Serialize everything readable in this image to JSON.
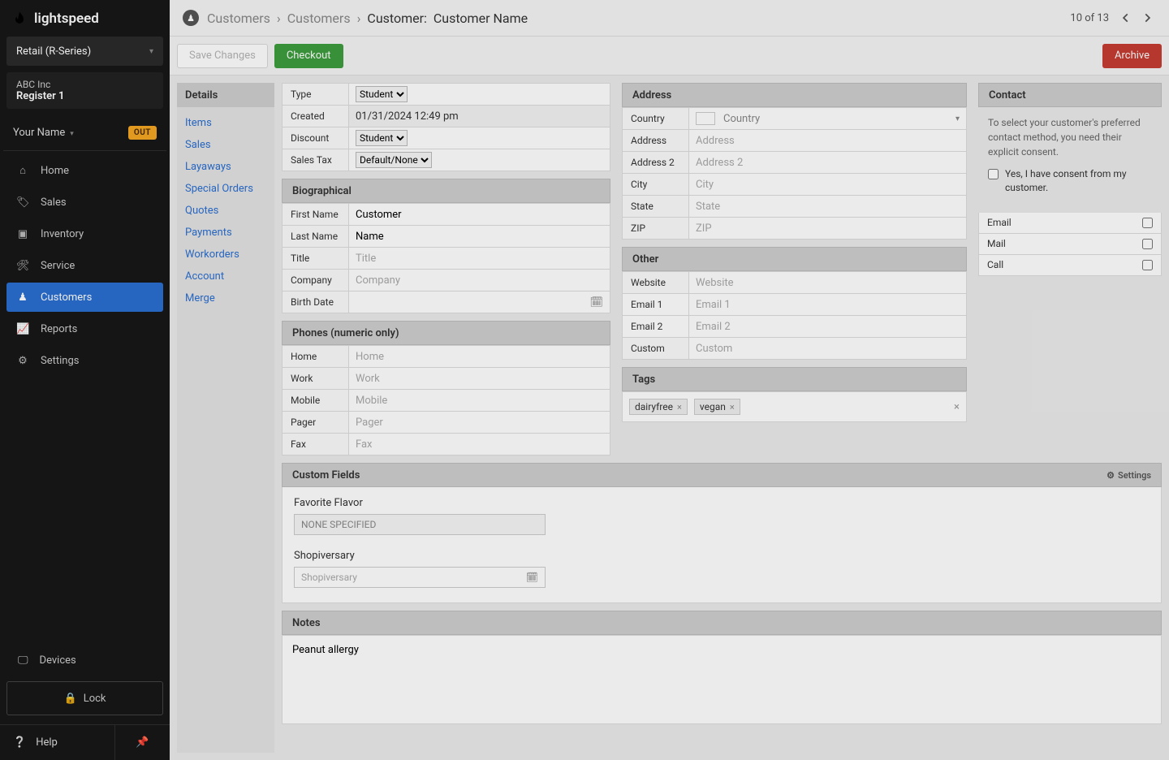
{
  "brand_name": "lightspeed",
  "product_selector": "Retail (R-Series)",
  "company": "ABC Inc",
  "register": "Register 1",
  "user_name": "Your Name",
  "out_badge": "OUT",
  "nav": {
    "home": "Home",
    "sales": "Sales",
    "inventory": "Inventory",
    "service": "Service",
    "customers": "Customers",
    "reports": "Reports",
    "settings": "Settings"
  },
  "devices_label": "Devices",
  "lock_label": "Lock",
  "help_label": "Help",
  "breadcrumbs": {
    "level1": "Customers",
    "level2": "Customers",
    "level3_prefix": "Customer: ",
    "level3_name": "Customer Name"
  },
  "pager": {
    "text": "10 of 13"
  },
  "actions": {
    "save": "Save Changes",
    "checkout": "Checkout",
    "archive": "Archive"
  },
  "details_nav": {
    "header": "Details",
    "items": [
      "Items",
      "Sales",
      "Layaways",
      "Special Orders",
      "Quotes",
      "Payments",
      "Workorders",
      "Account",
      "Merge"
    ]
  },
  "basic": {
    "type_label": "Type",
    "type_value": "Student",
    "created_label": "Created",
    "created_value": "01/31/2024 12:49 pm",
    "discount_label": "Discount",
    "discount_value": "Student",
    "salestax_label": "Sales Tax",
    "salestax_value": "Default/None"
  },
  "biographical": {
    "header": "Biographical",
    "first_label": "First Name",
    "first_value": "Customer",
    "last_label": "Last Name",
    "last_value": "Name",
    "title_label": "Title",
    "title_placeholder": "Title",
    "company_label": "Company",
    "company_placeholder": "Company",
    "birth_label": "Birth Date"
  },
  "phones": {
    "header": "Phones (numeric only)",
    "home_label": "Home",
    "home_ph": "Home",
    "work_label": "Work",
    "work_ph": "Work",
    "mobile_label": "Mobile",
    "mobile_ph": "Mobile",
    "pager_label": "Pager",
    "pager_ph": "Pager",
    "fax_label": "Fax",
    "fax_ph": "Fax"
  },
  "address": {
    "header": "Address",
    "country_label": "Country",
    "country_ph": "Country",
    "addr_label": "Address",
    "addr_ph": "Address",
    "addr2_label": "Address 2",
    "addr2_ph": "Address 2",
    "city_label": "City",
    "city_ph": "City",
    "state_label": "State",
    "state_ph": "State",
    "zip_label": "ZIP",
    "zip_ph": "ZIP"
  },
  "other": {
    "header": "Other",
    "website_label": "Website",
    "website_ph": "Website",
    "email1_label": "Email 1",
    "email1_ph": "Email 1",
    "email2_label": "Email 2",
    "email2_ph": "Email 2",
    "custom_label": "Custom",
    "custom_ph": "Custom"
  },
  "tags": {
    "header": "Tags",
    "items": [
      "dairyfree",
      "vegan"
    ]
  },
  "contact": {
    "header": "Contact",
    "msg": "To select your customer's preferred contact method, you need their explicit consent.",
    "consent_label": "Yes, I have consent from my customer.",
    "email_label": "Email",
    "mail_label": "Mail",
    "call_label": "Call"
  },
  "custom_fields": {
    "header": "Custom Fields",
    "settings_label": "Settings",
    "flavor_label": "Favorite Flavor",
    "flavor_value": "NONE SPECIFIED",
    "shop_label": "Shopiversary",
    "shop_ph": "Shopiversary"
  },
  "notes": {
    "header": "Notes",
    "text": "Peanut allergy"
  }
}
